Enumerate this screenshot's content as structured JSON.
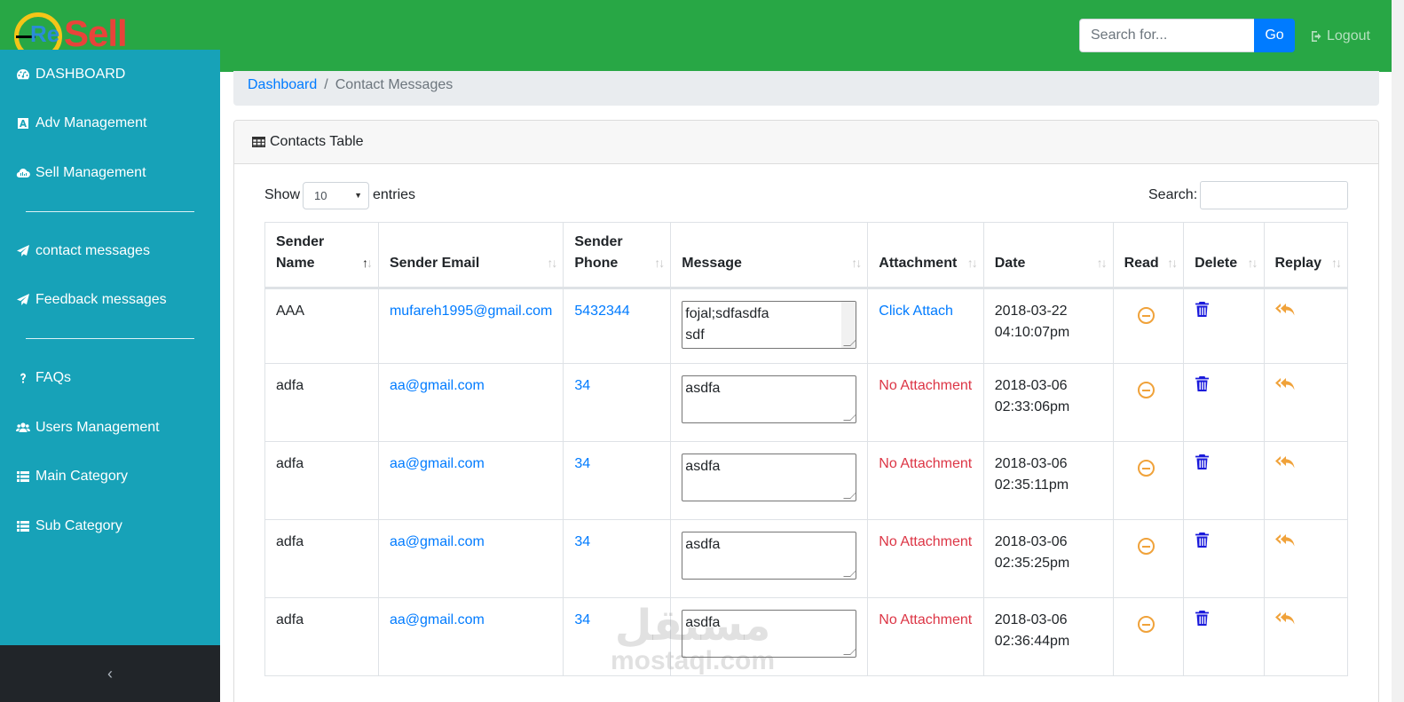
{
  "header": {
    "logo_re": "Re",
    "logo_sell": "Sell",
    "search_placeholder": "Search for...",
    "go_label": "Go",
    "logout_label": "Logout"
  },
  "sidebar": {
    "items": [
      {
        "label": "DASHBOARD",
        "icon": "dashboard-icon"
      },
      {
        "label": "Adv Management",
        "icon": "ad-icon"
      },
      {
        "label": "Sell Management",
        "icon": "cloud-icon"
      },
      {
        "label": "contact messages",
        "icon": "paper-plane-icon"
      },
      {
        "label": "Feedback messages",
        "icon": "paper-plane-icon"
      },
      {
        "label": "FAQs",
        "icon": "question-icon"
      },
      {
        "label": "Users Management",
        "icon": "users-icon"
      },
      {
        "label": "Main Category",
        "icon": "list-icon"
      },
      {
        "label": "Sub Category",
        "icon": "list-icon"
      }
    ],
    "collapse_label": "‹"
  },
  "breadcrumb": {
    "home": "Dashboard",
    "separator": "/",
    "current": "Contact Messages"
  },
  "card": {
    "title": "Contacts Table",
    "show_label": "Show",
    "page_size": "10",
    "entries_label": "entries",
    "search_label": "Search:"
  },
  "table": {
    "columns": [
      "Sender Name",
      "Sender Email",
      "Sender Phone",
      "Message",
      "Attachment",
      "Date",
      "Read",
      "Delete",
      "Replay"
    ],
    "rows": [
      {
        "name": "AAA",
        "email": "mufareh1995@gmail.com",
        "phone": "5432344",
        "message": "fojal;sdfasdfa\nsdf",
        "attachment": "Click Attach",
        "has_attachment": true,
        "date": "2018-03-22",
        "time": "04:10:07pm"
      },
      {
        "name": "adfa",
        "email": "aa@gmail.com",
        "phone": "34",
        "message": "asdfa",
        "attachment": "No Attachment",
        "has_attachment": false,
        "date": "2018-03-06",
        "time": "02:33:06pm"
      },
      {
        "name": "adfa",
        "email": "aa@gmail.com",
        "phone": "34",
        "message": "asdfa",
        "attachment": "No Attachment",
        "has_attachment": false,
        "date": "2018-03-06",
        "time": "02:35:11pm"
      },
      {
        "name": "adfa",
        "email": "aa@gmail.com",
        "phone": "34",
        "message": "asdfa",
        "attachment": "No Attachment",
        "has_attachment": false,
        "date": "2018-03-06",
        "time": "02:35:25pm"
      },
      {
        "name": "adfa",
        "email": "aa@gmail.com",
        "phone": "34",
        "message": "asdfa",
        "attachment": "No Attachment",
        "has_attachment": false,
        "date": "2018-03-06",
        "time": "02:36:44pm"
      }
    ]
  },
  "watermark": {
    "arabic": "مستقل",
    "latin": "mostaql.com"
  },
  "colors": {
    "topbar": "#28a745",
    "sidebar": "#17a2b8",
    "link": "#007bff",
    "danger": "#dc3545",
    "read_icon": "#f0a23a",
    "trash_icon": "#1a1adb",
    "reply_icon": "#f0a23a"
  }
}
